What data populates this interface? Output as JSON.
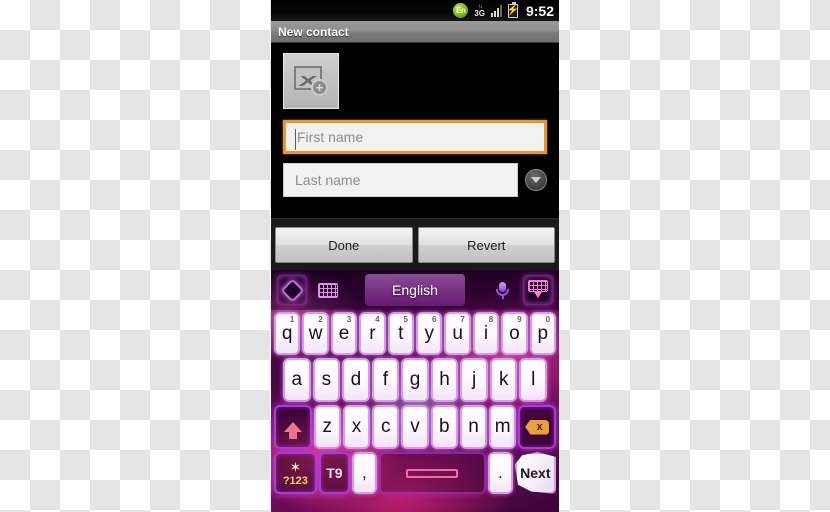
{
  "statusbar": {
    "lang_badge": "En",
    "network_arrows": "↑↓",
    "network_type": "3G",
    "signal_icon": "signal-bars-icon",
    "battery_icon": "battery-charging-icon",
    "battery_glyph": "⚡",
    "clock": "9:52"
  },
  "titlebar": {
    "title": "New contact"
  },
  "form": {
    "photo_button_name": "add-photo-button",
    "first_name": {
      "placeholder": "First name",
      "value": ""
    },
    "last_name": {
      "placeholder": "Last name",
      "value": ""
    },
    "expand_icon": "chevron-down-icon"
  },
  "buttonbar": {
    "done_label": "Done",
    "revert_label": "Revert"
  },
  "keyboard": {
    "top_bar": {
      "logo_icon": "keyboard-theme-logo-icon",
      "layout_icon": "keyboard-grid-icon",
      "language": "English",
      "mic_icon": "microphone-icon",
      "hide_icon": "hide-keyboard-icon"
    },
    "rows": [
      [
        {
          "label": "q",
          "sup": "1"
        },
        {
          "label": "w",
          "sup": "2"
        },
        {
          "label": "e",
          "sup": "3"
        },
        {
          "label": "r",
          "sup": "4"
        },
        {
          "label": "t",
          "sup": "5"
        },
        {
          "label": "y",
          "sup": "6"
        },
        {
          "label": "u",
          "sup": "7"
        },
        {
          "label": "i",
          "sup": "8"
        },
        {
          "label": "o",
          "sup": "9"
        },
        {
          "label": "p",
          "sup": "0"
        }
      ],
      [
        {
          "label": "a"
        },
        {
          "label": "s"
        },
        {
          "label": "d"
        },
        {
          "label": "f"
        },
        {
          "label": "g"
        },
        {
          "label": "h"
        },
        {
          "label": "j"
        },
        {
          "label": "k"
        },
        {
          "label": "l"
        }
      ],
      [
        {
          "label": "z"
        },
        {
          "label": "x"
        },
        {
          "label": "c"
        },
        {
          "label": "v"
        },
        {
          "label": "b"
        },
        {
          "label": "n"
        },
        {
          "label": "m"
        }
      ]
    ],
    "shift_key": {
      "icon": "shift-arrow-icon",
      "label": ""
    },
    "delete_key": {
      "icon": "backspace-icon",
      "label": "x"
    },
    "bottom_row": {
      "symbols_key": {
        "label": "?123",
        "icon": "gear-icon"
      },
      "t9_key": {
        "label": "T9"
      },
      "comma_key": {
        "label": ","
      },
      "space_key": {
        "label": "",
        "icon": "spacebar-icon"
      },
      "period_key": {
        "label": "."
      },
      "next_key": {
        "label": "Next"
      }
    }
  },
  "colors": {
    "accent_orange": "#e8952a",
    "keyboard_purple": "#a83cd6",
    "key_glow": "#e178fa",
    "status_green": "#8fe02a"
  }
}
